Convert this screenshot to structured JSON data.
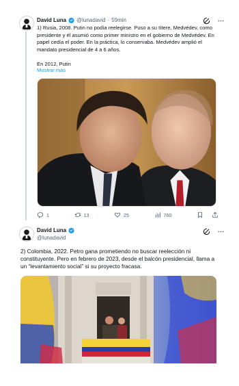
{
  "tweet1": {
    "author_name": "David Luna",
    "handle": "@lunadavid",
    "separator": "·",
    "time": "59min",
    "paragraphs": [
      "1) Rusia, 2008. Putin no podía reelegirse. Puso a su títere, Medvédev, como presidente y él asumió como primer ministro en el gobierno de Medvédev. En papel cedía el poder. En la práctica, lo conservaba. Medvédev amplió el mandato presidencial de 4 a 6 años.",
      "En 2012, Putin"
    ],
    "show_more": "Mostrar más",
    "media_alt": "Photo of Medvedev and Putin",
    "stats": {
      "replies": "1",
      "reposts": "13",
      "likes": "25",
      "views": "760"
    },
    "icons": [
      "grok-icon",
      "more-icon",
      "reply-icon",
      "repost-icon",
      "like-icon",
      "views-icon",
      "bookmark-icon",
      "share-icon"
    ]
  },
  "tweet2": {
    "author_name": "David Luna",
    "handle": "@lunadavid",
    "text": "2) Colombia, 2022. Petro gana prometiendo no buscar reelección ni constituyente. Pero en febrero de 2023, desde el balcón presidencial, llama a un “levantamiento social” si su proyecto fracasa.",
    "media_alt": "Photo of presidential balcony with Colombian flags",
    "icons": [
      "grok-icon",
      "more-icon"
    ]
  },
  "colors": {
    "accent": "#1d9bf0",
    "text_primary": "#0f1419",
    "text_secondary": "#536471",
    "thread_line": "#cfd9de"
  }
}
